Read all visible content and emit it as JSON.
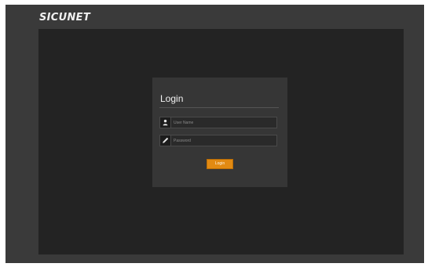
{
  "header": {
    "brand": "SICUNET"
  },
  "login": {
    "title": "Login",
    "username": {
      "placeholder": "User Name",
      "value": "",
      "icon": "user-icon"
    },
    "password": {
      "placeholder": "Password",
      "value": "",
      "icon": "pencil-icon"
    },
    "button_label": "Login"
  },
  "colors": {
    "frame": "#3a3a3a",
    "background": "#232323",
    "panel": "#363636",
    "accent": "#e28a12"
  }
}
